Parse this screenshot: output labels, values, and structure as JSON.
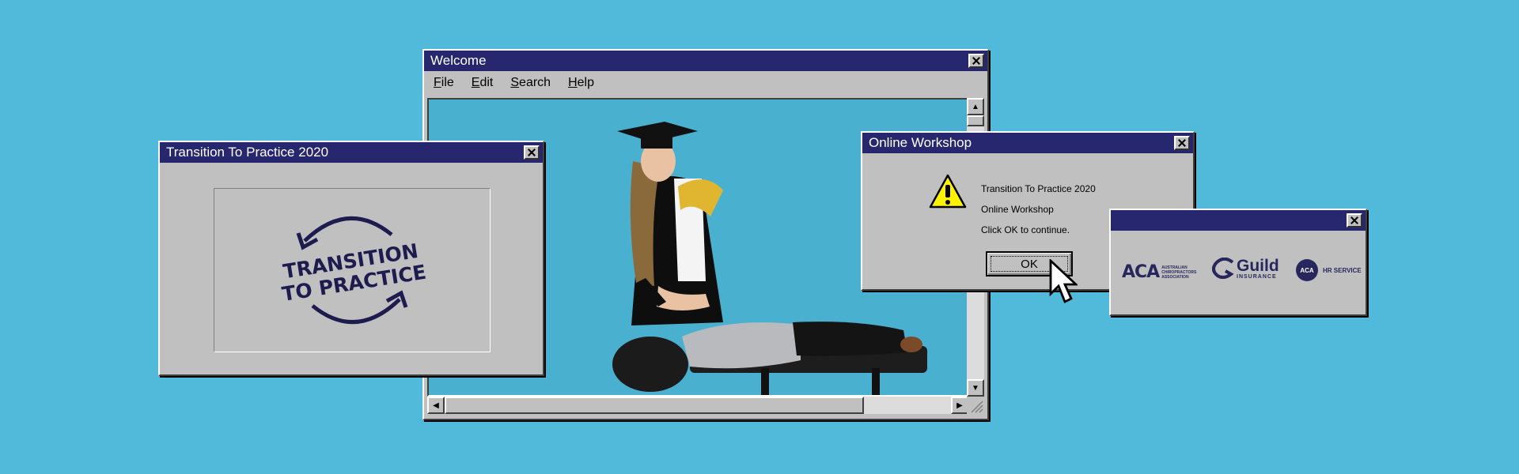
{
  "welcome": {
    "title": "Welcome",
    "menu": [
      "File",
      "Edit",
      "Search",
      "Help"
    ]
  },
  "transition": {
    "title": "Transition To Practice 2020",
    "logo_line1": "TRANSITION",
    "logo_line2": "TO PRACTICE"
  },
  "workshop": {
    "title": "Online Workshop",
    "line1": "Transition To Practice 2020",
    "line2": "Online Workshop",
    "line3": "Click OK to continue.",
    "ok_label": "OK"
  },
  "sponsors": {
    "title": "",
    "aca_mark": "ACA",
    "aca_text1": "AUSTRALIAN",
    "aca_text2": "CHIROPRACTORS",
    "aca_text3": "ASSOCIATION",
    "guild_name": "Guild",
    "guild_sub": "INSURANCE",
    "hr_mark": "ACA",
    "hr_text": "HR SERVICE"
  },
  "colors": {
    "background": "#51b9d9",
    "titlebar": "#27276f",
    "window": "#c0c0c0",
    "logo": "#1e1b4f"
  }
}
